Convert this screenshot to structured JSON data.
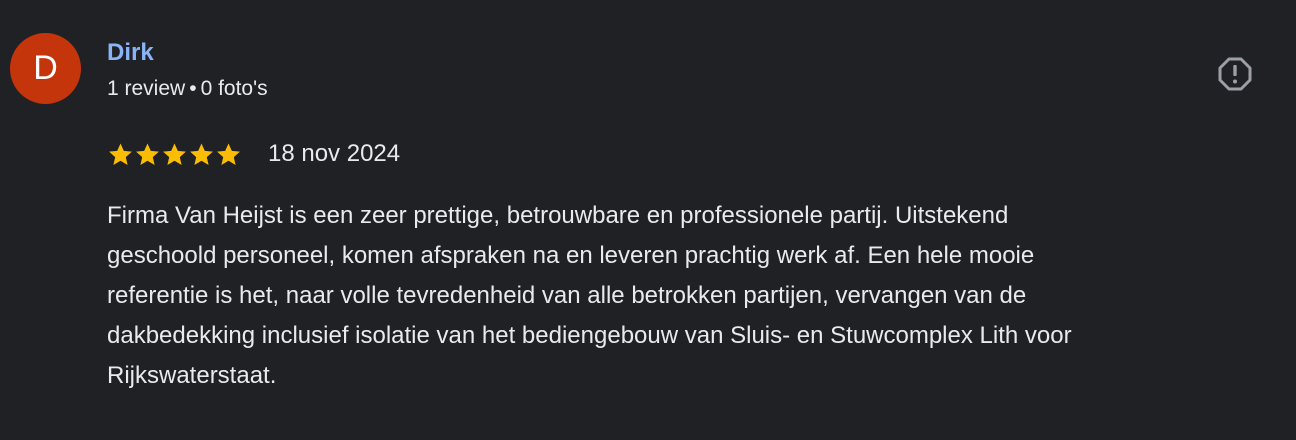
{
  "reviewer": {
    "avatar_letter": "D",
    "avatar_color": "#c5350c",
    "name": "Dirk",
    "review_count": "1 review",
    "separator": "•",
    "photo_count": "0 foto's"
  },
  "report_button": {
    "icon": "report-flag-octagon-icon"
  },
  "rating": {
    "stars": 5,
    "max_stars": 5,
    "star_color": "#fbbc04"
  },
  "date": "18 nov 2024",
  "review_text_lines": [
    "Firma Van Heijst is een zeer prettige, betrouwbare en professionele partij. Uitstekend",
    "geschoold personeel, komen afspraken na en leveren prachtig werk af. Een hele mooie",
    "referentie is het, naar volle tevredenheid van alle betrokken partijen, vervangen van de",
    "dakbedekking inclusief isolatie van het bediengebouw van Sluis- en Stuwcomplex Lith voor",
    "Rijkswaterstaat."
  ],
  "colors": {
    "background": "#202124",
    "text": "#e8eaed",
    "name": "#8ab4f8",
    "icon": "#9aa0a6"
  }
}
